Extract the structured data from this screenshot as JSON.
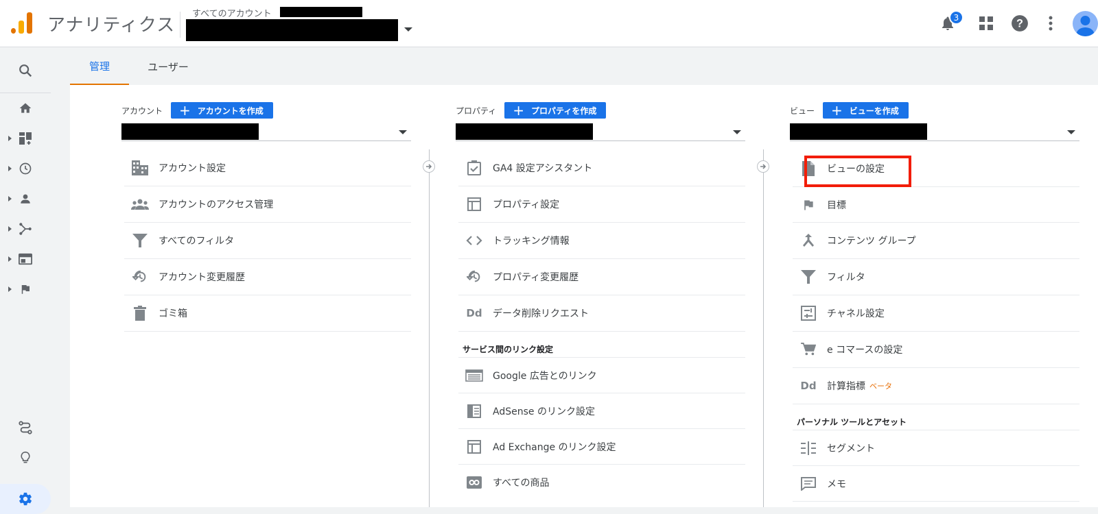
{
  "header": {
    "app_title": "アナリティクス",
    "account_label": "すべてのアカウント",
    "notification_count": "3"
  },
  "tabs": [
    {
      "label": "管理"
    },
    {
      "label": "ユーザー"
    }
  ],
  "columns": {
    "account": {
      "label": "アカウント",
      "create_label": "アカウントを作成",
      "items": [
        {
          "label": "アカウント設定",
          "icon": "building-icon"
        },
        {
          "label": "アカウントのアクセス管理",
          "icon": "people-icon"
        },
        {
          "label": "すべてのフィルタ",
          "icon": "filter-icon"
        },
        {
          "label": "アカウント変更履歴",
          "icon": "history-icon"
        },
        {
          "label": "ゴミ箱",
          "icon": "trash-icon"
        }
      ]
    },
    "property": {
      "label": "プロパティ",
      "create_label": "プロパティを作成",
      "items": [
        {
          "label": "GA4 設定アシスタント",
          "icon": "checklist-icon"
        },
        {
          "label": "プロパティ設定",
          "icon": "layout-icon"
        },
        {
          "label": "トラッキング情報",
          "icon": "code-icon"
        },
        {
          "label": "プロパティ変更履歴",
          "icon": "history-icon"
        },
        {
          "label": "データ削除リクエスト",
          "icon": "dd-icon",
          "icon_text": "Dd"
        }
      ],
      "section_title": "サービス間のリンク設定",
      "link_items": [
        {
          "label": "Google 広告とのリンク",
          "icon": "ads-icon"
        },
        {
          "label": "AdSense のリンク設定",
          "icon": "adsense-icon"
        },
        {
          "label": "Ad Exchange のリンク設定",
          "icon": "layout-icon"
        },
        {
          "label": "すべての商品",
          "icon": "link-icon"
        }
      ]
    },
    "view": {
      "label": "ビュー",
      "create_label": "ビューを作成",
      "items": [
        {
          "label": "ビューの設定",
          "icon": "document-icon"
        },
        {
          "label": "目標",
          "icon": "flag-icon"
        },
        {
          "label": "コンテンツ グループ",
          "icon": "merge-icon"
        },
        {
          "label": "フィルタ",
          "icon": "filter-icon"
        },
        {
          "label": "チャネル設定",
          "icon": "channel-icon"
        },
        {
          "label": "e コマースの設定",
          "icon": "cart-icon"
        },
        {
          "label": "計算指標",
          "icon": "dd-icon",
          "icon_text": "Dd",
          "badge": "ベータ"
        }
      ],
      "section_title": "パーソナル ツールとアセット",
      "personal_items": [
        {
          "label": "セグメント",
          "icon": "segment-icon"
        },
        {
          "label": "メモ",
          "icon": "comment-icon"
        }
      ]
    }
  },
  "colors": {
    "accent": "#1a73e8",
    "tab_underline": "#e37400",
    "highlight_box": "#f21d07",
    "beta": "#e8710a"
  }
}
